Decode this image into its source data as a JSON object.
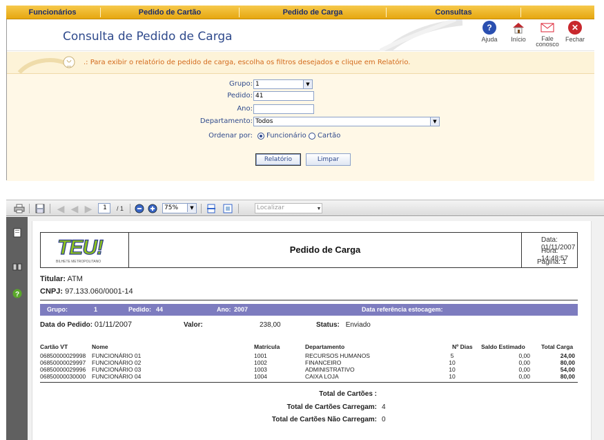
{
  "nav": {
    "items": [
      "Funcionários",
      "Pedido de Cartão",
      "Pedido de Carga",
      "Consultas"
    ]
  },
  "header": {
    "title": "Consulta de Pedido de Carga",
    "buttons": {
      "ajuda": "Ajuda",
      "inicio": "Início",
      "fale": "Fale conosco",
      "fechar": "Fechar"
    }
  },
  "banner": {
    "text": ".: Para exibir o relatório de pedido de carga, escolha os filtros desejados e clique em Relatório."
  },
  "form": {
    "grupo_label": "Grupo:",
    "grupo_value": "1",
    "pedido_label": "Pedido:",
    "pedido_value": "41",
    "ano_label": "Ano:",
    "ano_value": "",
    "departamento_label": "Departamento:",
    "departamento_value": "Todos",
    "ordenar_label": "Ordenar por:",
    "ordenar_options": [
      "Funcionário",
      "Cartão"
    ],
    "ordenar_selected": "Funcionário",
    "relatorio_button": "Relatório",
    "limpar_button": "Limpar"
  },
  "viewer": {
    "page_current": "1",
    "page_total": "/ 1",
    "zoom": "75%",
    "search_placeholder": "Localizar"
  },
  "report": {
    "logo_text": "TEU!",
    "logo_sub": "BILHETE METROPOLITANO",
    "title": "Pedido de Carga",
    "data_label": "Data:",
    "data_value": "01/11/2007",
    "hora_label": "Hora:",
    "hora_value": "14:48:57",
    "pagina_label": "Página:",
    "pagina_value": "1",
    "titular_label": "Titular:",
    "titular_value": "ATM",
    "cnpj_label": "CNPJ:",
    "cnpj_value": "97.133.060/0001-14",
    "bar": {
      "grupo_label": "Grupo:",
      "grupo_value": "1",
      "pedido_label": "Pedido:",
      "pedido_value": "44",
      "ano_label": "Ano:",
      "ano_value": "2007",
      "referencia": "Data referência estocagem:"
    },
    "data_pedido_label": "Data do Pedido:",
    "data_pedido_value": "01/11/2007",
    "valor_label": "Valor:",
    "valor_value": "238,00",
    "status_label": "Status:",
    "status_value": "Enviado",
    "columns": [
      "Cartão VT",
      "Nome",
      "Matrícula",
      "Departamento",
      "Nº Dias",
      "Saldo Estimado",
      "Total Carga"
    ],
    "rows": [
      [
        "06850000029998",
        "FUNCIONÁRIO 01",
        "1001",
        "RECURSOS HUMANOS",
        "5",
        "0,00",
        "24,00"
      ],
      [
        "06850000029997",
        "FUNCIONÁRIO 02",
        "1002",
        "FINANCEIRO",
        "10",
        "0,00",
        "80,00"
      ],
      [
        "06850000029996",
        "FUNCIONÁRIO 03",
        "1003",
        "ADMINISTRATIVO",
        "10",
        "0,00",
        "54,00"
      ],
      [
        "06850000030000",
        "FUNCIONÁRIO 04",
        "1004",
        "CAIXA LOJA",
        "10",
        "0,00",
        "80,00"
      ]
    ],
    "total_cartoes_label": "Total de Cartões :",
    "total_cartoes_value": "",
    "carregam_label": "Total de Cartões Carregam:",
    "carregam_value": "4",
    "nao_carregam_label": "Total de Cartões Não Carregam:",
    "nao_carregam_value": "0"
  }
}
